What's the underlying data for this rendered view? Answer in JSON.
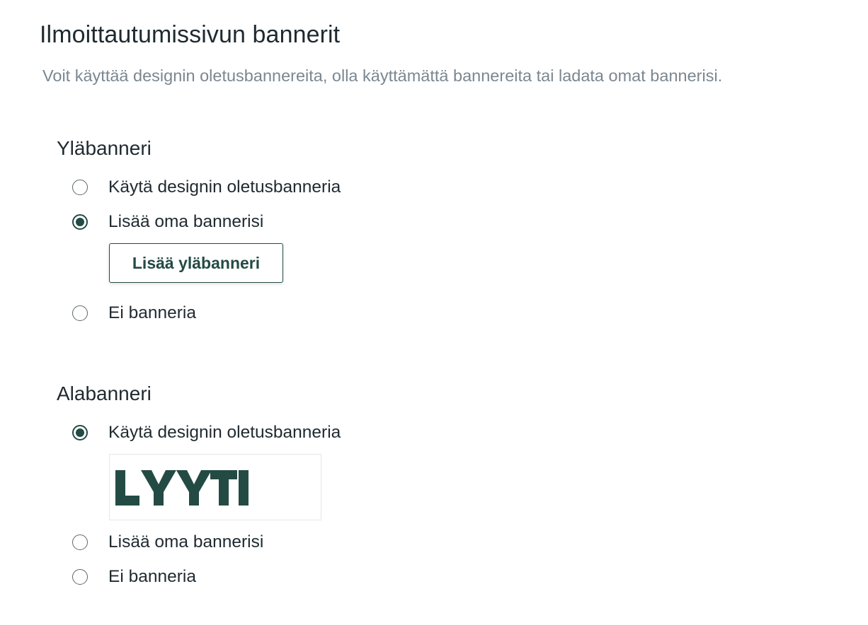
{
  "page": {
    "title": "Ilmoittautumissivun bannerit",
    "subtitle": "Voit käyttää designin oletusbannereita, olla käyttämättä bannereita tai ladata omat bannerisi."
  },
  "top_banner": {
    "title": "Yläbanneri",
    "options": [
      {
        "label": "Käytä designin oletusbanneria",
        "checked": false
      },
      {
        "label": "Lisää oma bannerisi",
        "checked": true
      },
      {
        "label": "Ei banneria",
        "checked": false
      }
    ],
    "add_button_label": "Lisää yläbanneri"
  },
  "bottom_banner": {
    "title": "Alabanneri",
    "options": [
      {
        "label": "Käytä designin oletusbanneria",
        "checked": true
      },
      {
        "label": "Lisää oma bannerisi",
        "checked": false
      },
      {
        "label": "Ei banneria",
        "checked": false
      }
    ],
    "preview_logo_text": "LYYTI"
  },
  "colors": {
    "accent": "#234b44",
    "text": "#1f2a30",
    "muted": "#7b8790"
  }
}
